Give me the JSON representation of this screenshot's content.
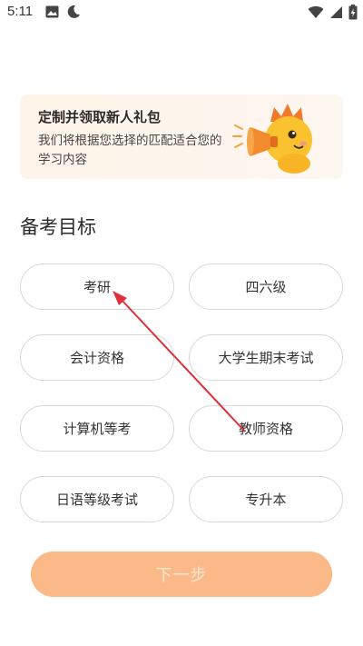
{
  "status_bar": {
    "time": "5:11"
  },
  "banner": {
    "title": "定制并领取新人礼包",
    "description": "我们将根据您选择的匹配适合您的学习内容"
  },
  "section": {
    "title": "备考目标"
  },
  "options": [
    "考研",
    "四六级",
    "会计资格",
    "大学生期末考试",
    "计算机等考",
    "教师资格",
    "日语等级考试",
    "专升本"
  ],
  "next_button": {
    "label": "下一步"
  },
  "colors": {
    "accent": "#fbb888",
    "annotation_arrow": "#e0303a"
  }
}
